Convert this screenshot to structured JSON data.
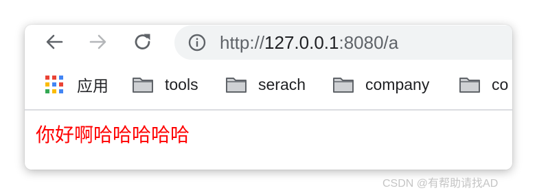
{
  "browser": {
    "nav": {
      "back_icon": "arrow-left-icon",
      "forward_icon": "arrow-right-icon",
      "reload_icon": "reload-icon"
    },
    "omnibox": {
      "info_icon": "info-circle-icon",
      "scheme": "http://",
      "host": "127.0.0.1",
      "port_path": ":8080/a"
    },
    "bookmarks": [
      {
        "label": "应用",
        "icon": "apps-grid-icon"
      },
      {
        "label": "tools",
        "icon": "folder-icon"
      },
      {
        "label": "serach",
        "icon": "folder-icon"
      },
      {
        "label": "company",
        "icon": "folder-icon"
      },
      {
        "label": "co",
        "icon": "folder-icon"
      }
    ]
  },
  "page": {
    "text": "你好啊哈哈哈哈哈",
    "text_color": "#ff0000"
  },
  "watermark": {
    "text": "CSDN @有帮助请找AD"
  },
  "colors": {
    "omnibox_bg": "#f1f3f4",
    "icon_gray": "#5f6368",
    "disabled_gray": "#b4b6b9",
    "folder_fill": "#cfd1d4",
    "folder_stroke": "#5f6368",
    "apps_colors": [
      "#ea4335",
      "#ea4335",
      "#4285f4",
      "#fbbc05",
      "#4285f4",
      "#ea4335",
      "#34a853",
      "#fbbc05",
      "#4285f4"
    ]
  }
}
